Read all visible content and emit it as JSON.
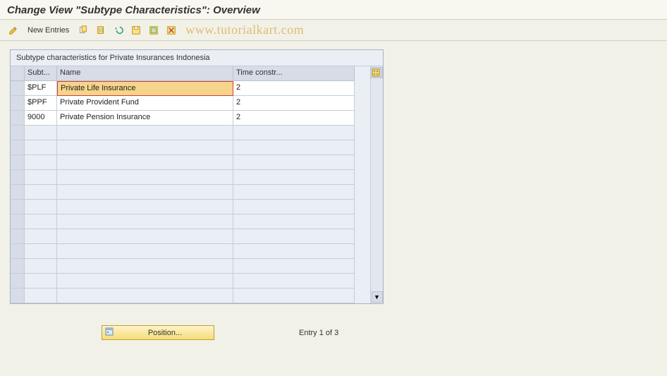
{
  "header": {
    "title": "Change View \"Subtype Characteristics\": Overview"
  },
  "toolbar": {
    "new_entries_label": "New Entries"
  },
  "watermark": "www.tutorialkart.com",
  "group": {
    "title": "Subtype characteristics for Private Insurances Indonesia"
  },
  "columns": {
    "subtype": "Subt...",
    "name": "Name",
    "time_constraint": "Time constr..."
  },
  "rows": [
    {
      "subtype": "$PLF",
      "name": "Private Life Insurance",
      "tc": "2"
    },
    {
      "subtype": "$PPF",
      "name": "Private Provident Fund",
      "tc": "2"
    },
    {
      "subtype": "9000",
      "name": "Private Pension Insurance",
      "tc": "2"
    }
  ],
  "footer": {
    "position_label": "Position...",
    "entry_text": "Entry 1 of 3"
  }
}
